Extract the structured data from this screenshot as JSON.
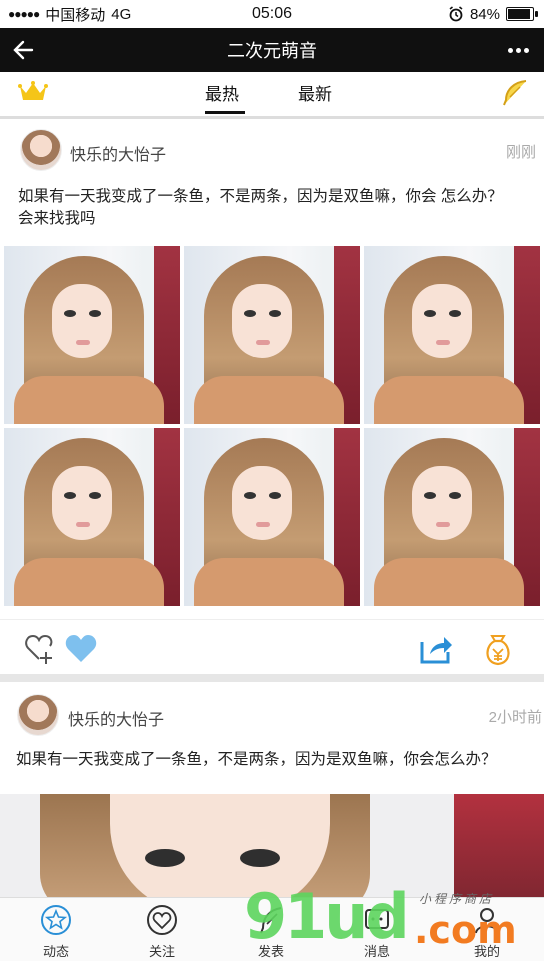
{
  "status_bar": {
    "carrier": "中国移动",
    "network": "4G",
    "time": "05:06",
    "battery": "84%",
    "battery_level": 0.84
  },
  "header": {
    "title": "二次元萌音"
  },
  "tabs": {
    "hot": "最热",
    "new": "最新"
  },
  "posts": [
    {
      "user": "快乐的大怡子",
      "time": "刚刚",
      "content_line1": "如果有一天我变成了一条鱼，不是两条，因为是双鱼嘛，你会 怎么办？",
      "content_line2": "会来找我吗",
      "image_count": 6
    },
    {
      "user": "快乐的大怡子",
      "time": "2小时前",
      "content": "如果有一天我变成了一条鱼，不是两条，因为是双鱼嘛，你会怎么办？"
    }
  ],
  "bottom_nav": [
    {
      "label": "动态",
      "icon": "star-icon"
    },
    {
      "label": "关注",
      "icon": "heart-icon"
    },
    {
      "label": "发表",
      "icon": "feather-icon"
    },
    {
      "label": "消息",
      "icon": "message-icon"
    },
    {
      "label": "我的",
      "icon": "person-icon"
    }
  ],
  "watermark": {
    "brand": "91ud",
    "tld": ".com",
    "tagline": "小程序商店"
  },
  "colors": {
    "header_bg": "#101010",
    "crown": "#f5c518",
    "accent_blue": "#2a8fd6",
    "like_blue": "#7ec0ee",
    "coin_orange": "#f0a020"
  }
}
